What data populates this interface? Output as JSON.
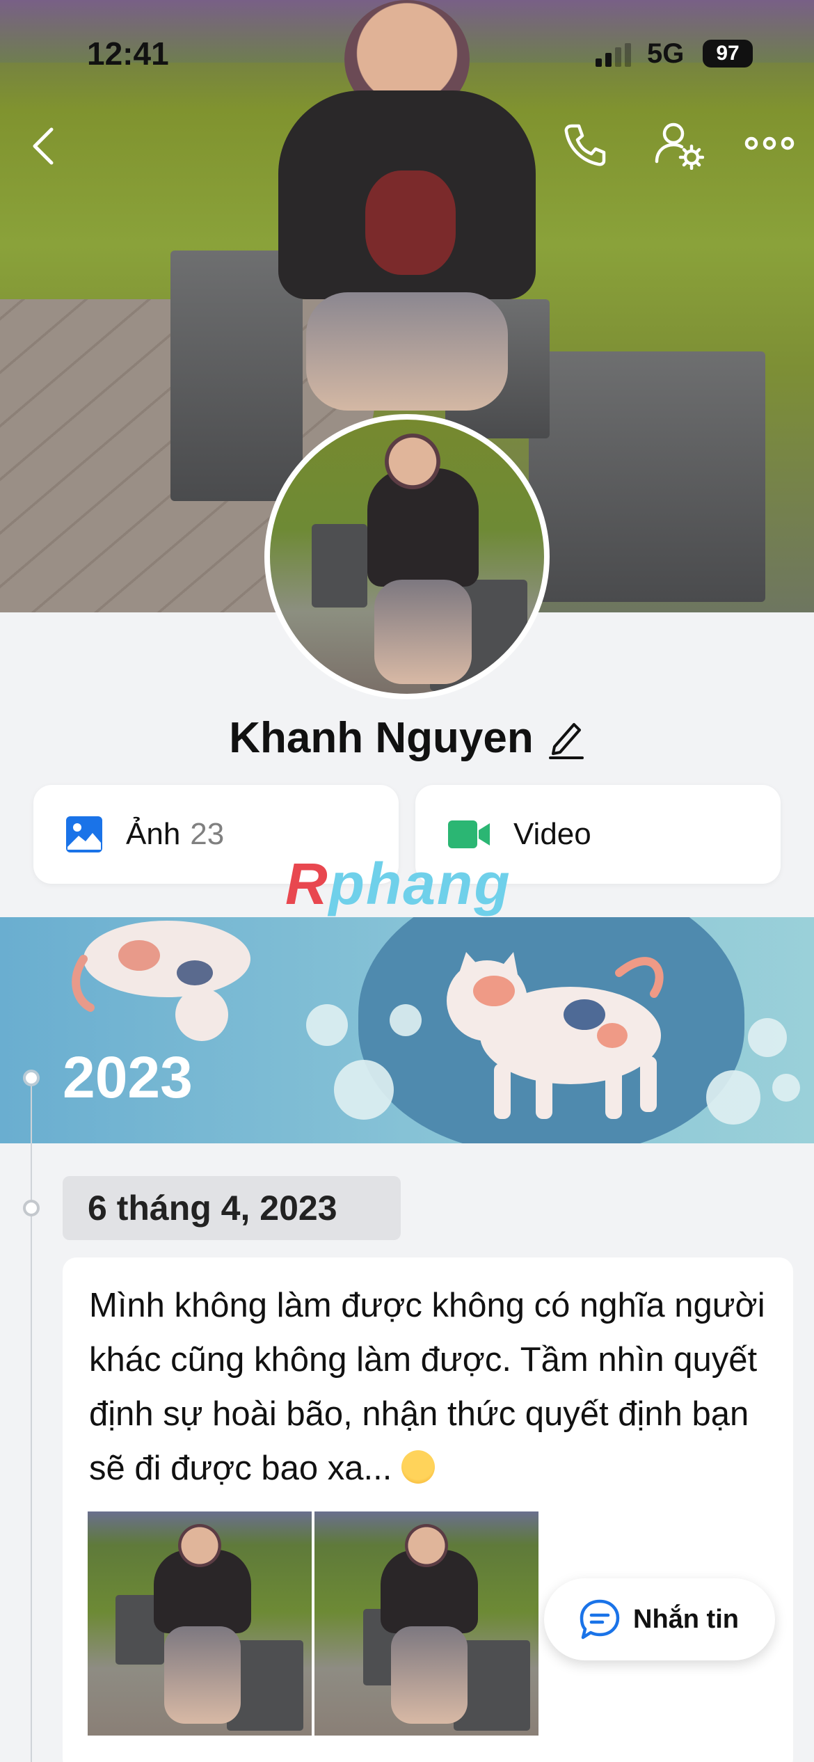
{
  "status_bar": {
    "time": "12:41",
    "network": "5G",
    "battery": "97"
  },
  "header": {
    "back_icon": "chevron-left-icon",
    "call_icon": "phone-icon",
    "settings_icon": "user-gear-icon",
    "more_icon": "more-horizontal-icon"
  },
  "profile": {
    "name": "Khanh Nguyen",
    "edit_icon": "pencil-icon"
  },
  "media": {
    "photos_label": "Ảnh",
    "photos_count": "23",
    "video_label": "Video"
  },
  "watermark": {
    "prefix": "R",
    "rest": "phang"
  },
  "timeline": {
    "year": "2023",
    "date": "6 tháng 4, 2023",
    "post_text": "Mình không làm được không có nghĩa người khác cũng không làm được. Tầm nhìn quyết định sự hoài bão, nhận thức quyết định bạn sẽ đi được bao xa..."
  },
  "message_button": {
    "label": "Nhắn tin"
  },
  "colors": {
    "accent_blue": "#1a73e8",
    "video_green": "#2bb673",
    "banner_blue": "#6aaed0",
    "page_bg": "#f2f3f5"
  }
}
